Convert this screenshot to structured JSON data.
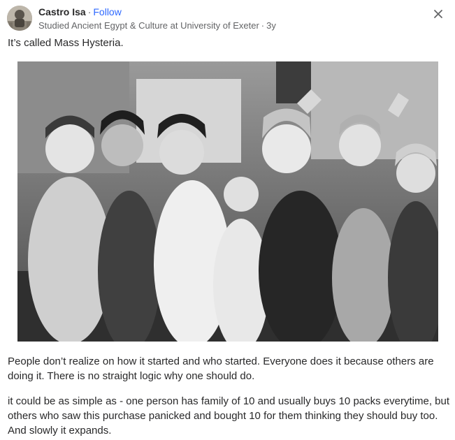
{
  "header": {
    "author_name": "Castro Isa",
    "separator": "·",
    "follow_label": "Follow",
    "credential": "Studied Ancient Egypt & Culture at University of Exeter",
    "time": "3y",
    "avatar_icon": "user-avatar-photo",
    "close_icon": "close-icon"
  },
  "answer": {
    "intro": "It’s called Mass Hysteria.",
    "image_icon": "photo-screaming-crowd",
    "paragraph_1": "People don’t realize on how it started and who started. Everyone does it because others are doing it. There is no straight logic why one should do.",
    "paragraph_2": "it could be as simple as - one person has family of 10 and usually buys 10 packs everytime, but others who saw this purchase panicked and bought 10 for them thinking they should buy too. And slowly it expands."
  },
  "colors": {
    "text": "#282829",
    "secondary": "#636466",
    "link": "#2e69ff"
  }
}
